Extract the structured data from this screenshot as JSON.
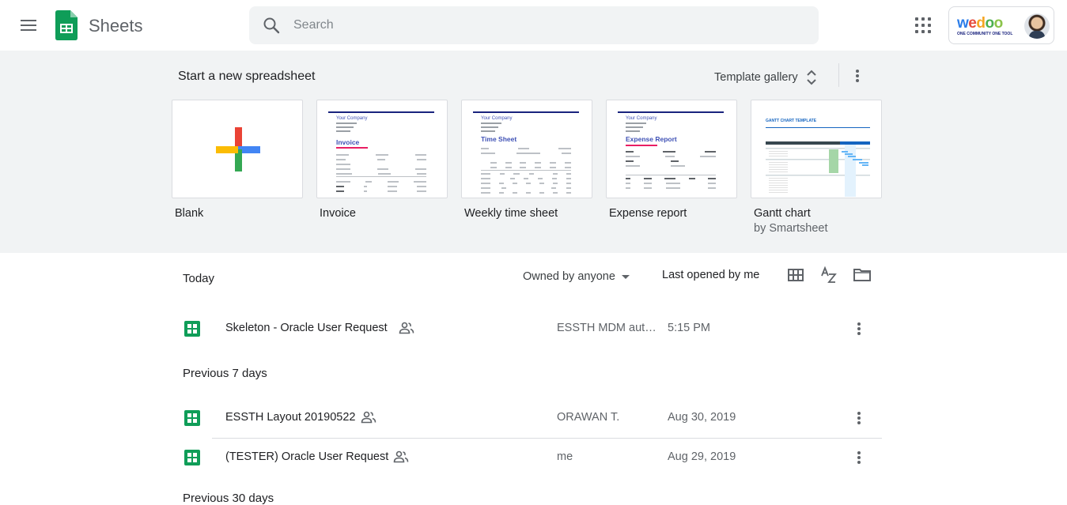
{
  "app": {
    "name": "Sheets"
  },
  "search": {
    "placeholder": "Search"
  },
  "account": {
    "brand": "wedoo",
    "tagline": "ONE COMMUNITY ONE TOOL"
  },
  "templates": {
    "title": "Start a new spreadsheet",
    "gallery_label": "Template gallery",
    "items": [
      {
        "name": "Blank",
        "sub": ""
      },
      {
        "name": "Invoice",
        "sub": "",
        "thumb_company": "Your Company",
        "thumb_title": "Invoice"
      },
      {
        "name": "Weekly time sheet",
        "sub": "",
        "thumb_company": "Your Company",
        "thumb_title": "Time Sheet"
      },
      {
        "name": "Expense report",
        "sub": "",
        "thumb_company": "Your Company",
        "thumb_title": "Expense Report"
      },
      {
        "name": "Gantt chart",
        "sub": "by Smartsheet",
        "thumb_title": "GANTT CHART TEMPLATE"
      }
    ]
  },
  "list": {
    "owner_filter": "Owned by anyone",
    "sort_label": "Last opened by me",
    "sections": [
      {
        "title": "Today",
        "files": [
          {
            "name": "Skeleton - Oracle User Request",
            "owner": "ESSTH MDM auto...",
            "date": "5:15 PM",
            "shared": true
          }
        ]
      },
      {
        "title": "Previous 7 days",
        "files": [
          {
            "name": "ESSTH Layout 20190522",
            "owner": "ORAWAN T.",
            "date": "Aug 30, 2019",
            "shared": true
          },
          {
            "name": "(TESTER) Oracle User Request",
            "owner": "me",
            "date": "Aug 29, 2019",
            "shared": true
          }
        ]
      },
      {
        "title": "Previous 30 days",
        "files": []
      }
    ]
  },
  "colors": {
    "sheets_green": "#0f9d58",
    "band_bg": "#f1f3f4",
    "plus_red": "#ea4335",
    "plus_blue": "#4285f4",
    "plus_yellow": "#fbbc04",
    "plus_green": "#34a853"
  }
}
